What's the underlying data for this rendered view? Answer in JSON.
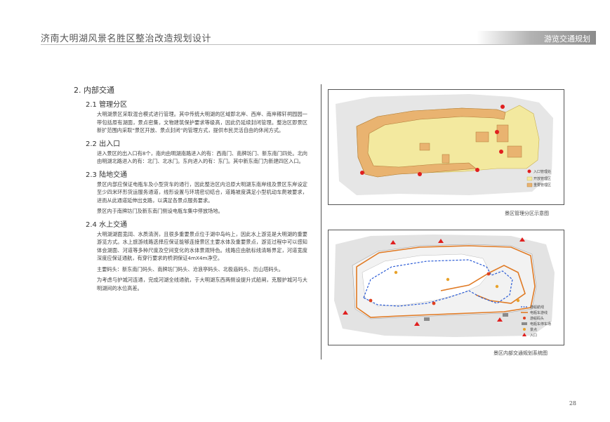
{
  "header": {
    "title": "济南大明湖风景名胜区整治改造规划设计",
    "tag": "游览交通规划"
  },
  "content": {
    "section_title": "2. 内部交通",
    "s1_title": "2.1 管理分区",
    "s1_p1": "大明湖景区采取混合模式进行管理。其中传统大明湖的区域即北岸、西岸、南岸稼轩祠园园一带包括原有湖面，景点密集，文物建筑保护要求等级高，因此仍延续封闭管理。整治区即景区新扩范围内采取“景区开放、景点封闭”的管理方式，提供市民灵活自由的休闲方式。",
    "s2_title": "2.2 出入口",
    "s2_p1": "进入景区的出入口有8个，南向由明湖南路进入的有：西南门、南牌坊门、新东南门四处。北向由明湖北路进入的有：北门、北水门。东向进入的有：东门。其中新东南门为新建四区入口。",
    "s3_title": "2.3 陆地交通",
    "s3_p1": "景区内部应保证电瓶车及小型货车的通行，因此整治区内沿原大明湖东南岸线及景区东岸设定至少四米环形货运服务通道，线形设置与环境密切结合，道路坡度满足小型机动车爬坡要求，进而从此通道延伸出支路，以满足各景点服务要求。",
    "s3_p2": "景区内于南牌坊门及新东南门侧设电瓶车集中停放场地。",
    "s4_title": "2.4 水上交通",
    "s4_p1": "大明湖湖面宽阔、水质清洌，且很多重要景点位于湖中岛屿上，因此水上游览是大明湖的重要游览方式。水上旅游线路选择应保证能够连接景区主要水体及重要景点，游览过程中可以感知体会湖面、河道等多种尺度及空间变化的水体景观特色。线路应由航标线清晰界定，河道宽度深度应保证通航，有穿行要求的桥洞保证4mX4m净空。",
    "s4_p2": "主要码头：新东南门码头、南牌坊门码头、沧浪亭码头、北极庙码头、历山塔码头。",
    "s4_p3": "为考虑与护城河连通，完成河湖全线通航，于大明湖东西两侧设提升式船闸，克服护城河与大明湖间的水位高差。"
  },
  "map1": {
    "caption": "景区管理分区示意图",
    "legend": [
      "入口管理处",
      "开放管理区",
      "重要管理区"
    ],
    "colors": {
      "entrance": "#e01f1f",
      "open": "#f3e99f",
      "closed": "#e9b370"
    }
  },
  "map2": {
    "caption": "景区内部交通规划系统图",
    "legend": [
      "游船航线",
      "电瓶车游线",
      "游船码头",
      "电瓶车停车场",
      "景点",
      "入口"
    ],
    "colors": {
      "boat": "#2b5cd6",
      "cart": "#e07a24",
      "pier": "#e0401f",
      "parking": "#8a8a8a",
      "spot": "#e8a22a",
      "entrance": "#e01f1f"
    }
  },
  "page_number": "28"
}
